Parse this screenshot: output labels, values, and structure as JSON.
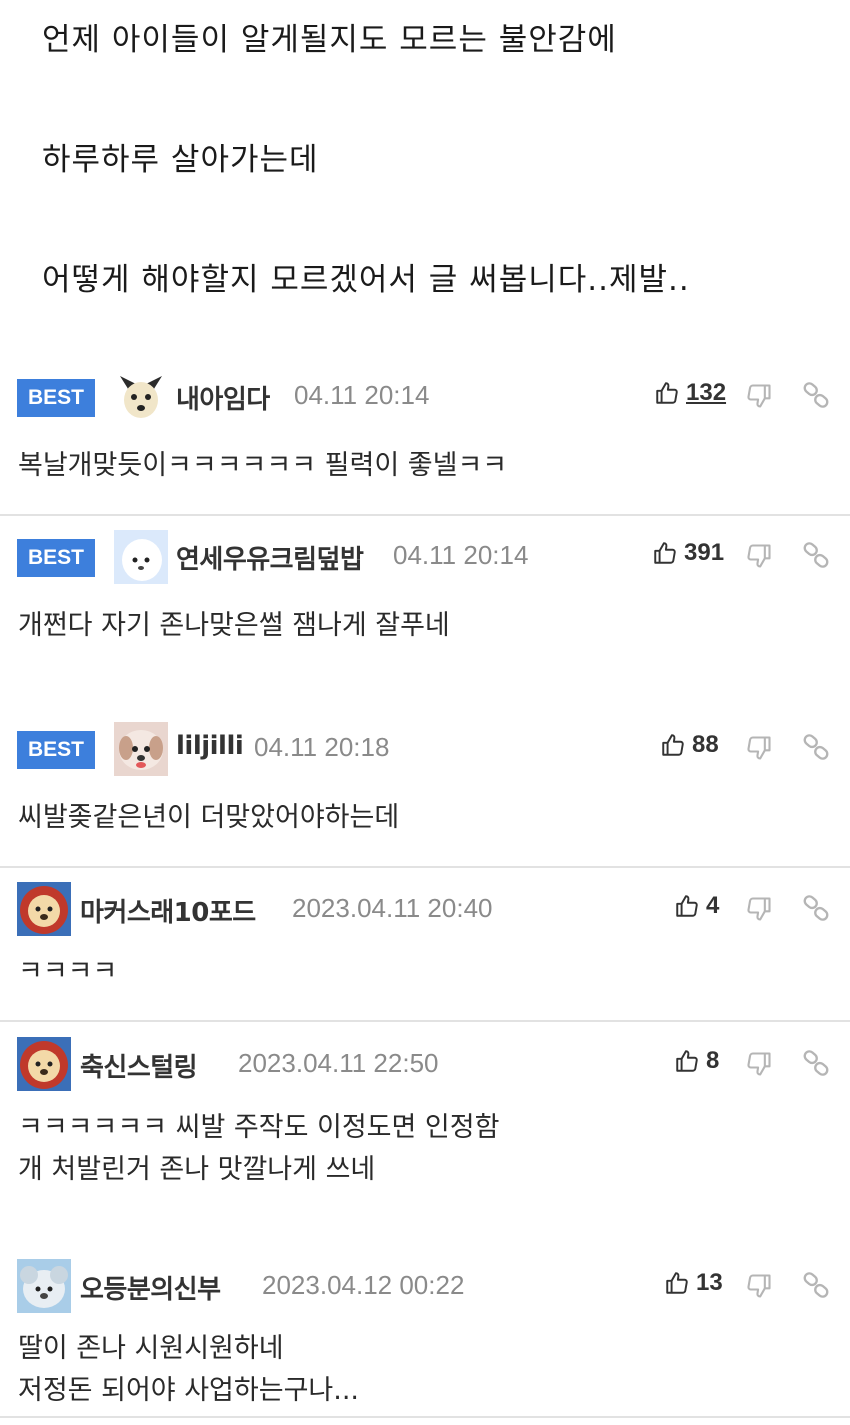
{
  "post": {
    "lines": [
      "언제 아이들이 알게될지도 모르는 불안감에",
      "하루하루 살아가는데",
      "어떻게 해야할지 모르겠어서 글 써봅니다..제발.."
    ]
  },
  "best_label": "BEST",
  "comments": [
    {
      "best": true,
      "nick": "내아임다",
      "date": "04.11 20:14",
      "likes": "132",
      "text": [
        "복날개맞듯이ㅋㅋㅋㅋㅋㅋ 필력이 좋넬ㅋㅋ"
      ]
    },
    {
      "best": true,
      "nick": "연세우유크림덮밥",
      "date": "04.11 20:14",
      "likes": "391",
      "text": [
        "개쩐다 자기 존나맞은썰 잼나게 잘푸네"
      ]
    },
    {
      "best": true,
      "nick": "liljilli",
      "date": "04.11 20:18",
      "likes": "88",
      "text": [
        "씨발좆같은년이 더맞았어야하는데"
      ]
    },
    {
      "best": false,
      "nick": "마커스래10포드",
      "date": "2023.04.11 20:40",
      "likes": "4",
      "text": [
        "ㅋㅋㅋㅋ"
      ]
    },
    {
      "best": false,
      "nick": "축신스털링",
      "date": "2023.04.11 22:50",
      "likes": "8",
      "text": [
        "ㅋㅋㅋㅋㅋㅋ 씨발 주작도 이정도면 인정함",
        "개 처발린거 존나 맛깔나게 쓰네"
      ]
    },
    {
      "best": false,
      "nick": "오등분의신부",
      "date": "2023.04.12 00:22",
      "likes": "13",
      "text": [
        "딸이 존나 시원시원하네",
        "저정돈 되어야 사업하는구나..."
      ]
    }
  ],
  "icons": {
    "like": "thumbs-up-icon",
    "dislike": "thumbs-down-icon",
    "link": "link-icon"
  },
  "colors": {
    "best_badge": "#3d7fdc",
    "date": "#8a8a8a",
    "separator": "#e2e2e2"
  }
}
